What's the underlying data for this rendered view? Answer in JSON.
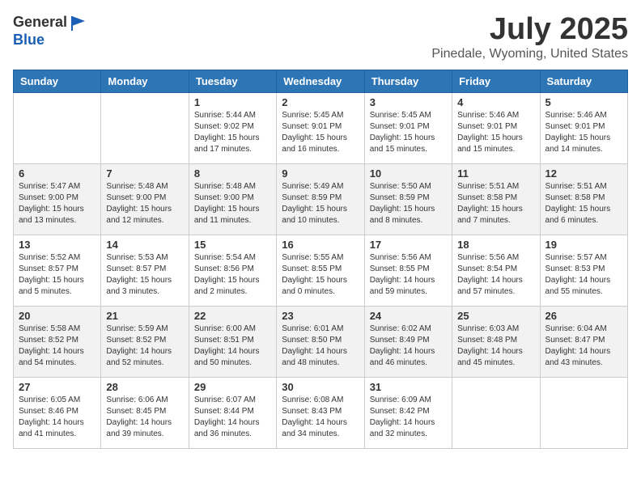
{
  "header": {
    "logo_general": "General",
    "logo_blue": "Blue",
    "title": "July 2025",
    "location": "Pinedale, Wyoming, United States"
  },
  "calendar": {
    "columns": [
      "Sunday",
      "Monday",
      "Tuesday",
      "Wednesday",
      "Thursday",
      "Friday",
      "Saturday"
    ],
    "weeks": [
      [
        {
          "day": "",
          "info": ""
        },
        {
          "day": "",
          "info": ""
        },
        {
          "day": "1",
          "info": "Sunrise: 5:44 AM\nSunset: 9:02 PM\nDaylight: 15 hours and 17 minutes."
        },
        {
          "day": "2",
          "info": "Sunrise: 5:45 AM\nSunset: 9:01 PM\nDaylight: 15 hours and 16 minutes."
        },
        {
          "day": "3",
          "info": "Sunrise: 5:45 AM\nSunset: 9:01 PM\nDaylight: 15 hours and 15 minutes."
        },
        {
          "day": "4",
          "info": "Sunrise: 5:46 AM\nSunset: 9:01 PM\nDaylight: 15 hours and 15 minutes."
        },
        {
          "day": "5",
          "info": "Sunrise: 5:46 AM\nSunset: 9:01 PM\nDaylight: 15 hours and 14 minutes."
        }
      ],
      [
        {
          "day": "6",
          "info": "Sunrise: 5:47 AM\nSunset: 9:00 PM\nDaylight: 15 hours and 13 minutes."
        },
        {
          "day": "7",
          "info": "Sunrise: 5:48 AM\nSunset: 9:00 PM\nDaylight: 15 hours and 12 minutes."
        },
        {
          "day": "8",
          "info": "Sunrise: 5:48 AM\nSunset: 9:00 PM\nDaylight: 15 hours and 11 minutes."
        },
        {
          "day": "9",
          "info": "Sunrise: 5:49 AM\nSunset: 8:59 PM\nDaylight: 15 hours and 10 minutes."
        },
        {
          "day": "10",
          "info": "Sunrise: 5:50 AM\nSunset: 8:59 PM\nDaylight: 15 hours and 8 minutes."
        },
        {
          "day": "11",
          "info": "Sunrise: 5:51 AM\nSunset: 8:58 PM\nDaylight: 15 hours and 7 minutes."
        },
        {
          "day": "12",
          "info": "Sunrise: 5:51 AM\nSunset: 8:58 PM\nDaylight: 15 hours and 6 minutes."
        }
      ],
      [
        {
          "day": "13",
          "info": "Sunrise: 5:52 AM\nSunset: 8:57 PM\nDaylight: 15 hours and 5 minutes."
        },
        {
          "day": "14",
          "info": "Sunrise: 5:53 AM\nSunset: 8:57 PM\nDaylight: 15 hours and 3 minutes."
        },
        {
          "day": "15",
          "info": "Sunrise: 5:54 AM\nSunset: 8:56 PM\nDaylight: 15 hours and 2 minutes."
        },
        {
          "day": "16",
          "info": "Sunrise: 5:55 AM\nSunset: 8:55 PM\nDaylight: 15 hours and 0 minutes."
        },
        {
          "day": "17",
          "info": "Sunrise: 5:56 AM\nSunset: 8:55 PM\nDaylight: 14 hours and 59 minutes."
        },
        {
          "day": "18",
          "info": "Sunrise: 5:56 AM\nSunset: 8:54 PM\nDaylight: 14 hours and 57 minutes."
        },
        {
          "day": "19",
          "info": "Sunrise: 5:57 AM\nSunset: 8:53 PM\nDaylight: 14 hours and 55 minutes."
        }
      ],
      [
        {
          "day": "20",
          "info": "Sunrise: 5:58 AM\nSunset: 8:52 PM\nDaylight: 14 hours and 54 minutes."
        },
        {
          "day": "21",
          "info": "Sunrise: 5:59 AM\nSunset: 8:52 PM\nDaylight: 14 hours and 52 minutes."
        },
        {
          "day": "22",
          "info": "Sunrise: 6:00 AM\nSunset: 8:51 PM\nDaylight: 14 hours and 50 minutes."
        },
        {
          "day": "23",
          "info": "Sunrise: 6:01 AM\nSunset: 8:50 PM\nDaylight: 14 hours and 48 minutes."
        },
        {
          "day": "24",
          "info": "Sunrise: 6:02 AM\nSunset: 8:49 PM\nDaylight: 14 hours and 46 minutes."
        },
        {
          "day": "25",
          "info": "Sunrise: 6:03 AM\nSunset: 8:48 PM\nDaylight: 14 hours and 45 minutes."
        },
        {
          "day": "26",
          "info": "Sunrise: 6:04 AM\nSunset: 8:47 PM\nDaylight: 14 hours and 43 minutes."
        }
      ],
      [
        {
          "day": "27",
          "info": "Sunrise: 6:05 AM\nSunset: 8:46 PM\nDaylight: 14 hours and 41 minutes."
        },
        {
          "day": "28",
          "info": "Sunrise: 6:06 AM\nSunset: 8:45 PM\nDaylight: 14 hours and 39 minutes."
        },
        {
          "day": "29",
          "info": "Sunrise: 6:07 AM\nSunset: 8:44 PM\nDaylight: 14 hours and 36 minutes."
        },
        {
          "day": "30",
          "info": "Sunrise: 6:08 AM\nSunset: 8:43 PM\nDaylight: 14 hours and 34 minutes."
        },
        {
          "day": "31",
          "info": "Sunrise: 6:09 AM\nSunset: 8:42 PM\nDaylight: 14 hours and 32 minutes."
        },
        {
          "day": "",
          "info": ""
        },
        {
          "day": "",
          "info": ""
        }
      ]
    ]
  }
}
